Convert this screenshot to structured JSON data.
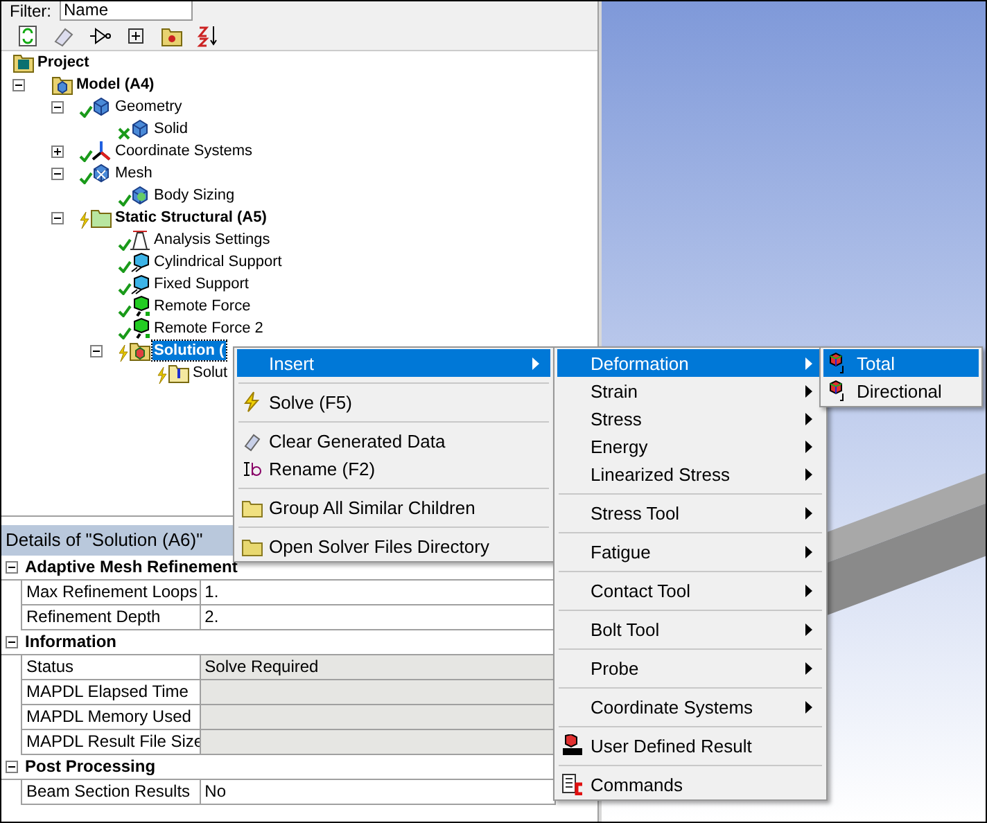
{
  "filter": {
    "label": "Filter:",
    "value": "Name"
  },
  "tree": {
    "label": "Project",
    "selected": false,
    "kind": "project",
    "children": [
      {
        "label": "Model (A4)",
        "selected": false,
        "kind": "model",
        "expanded": true,
        "children": [
          {
            "label": "Geometry",
            "selected": false,
            "solved": true,
            "kind": "geometry",
            "expanded": true,
            "children": [
              {
                "label": "Solid",
                "selected": false,
                "solved": true,
                "kind": "body"
              }
            ]
          },
          {
            "label": "Coordinate Systems",
            "selected": false,
            "solved": true,
            "kind": "axes",
            "expanded": false
          },
          {
            "label": "Mesh",
            "selected": false,
            "solved": true,
            "kind": "mesh",
            "expanded": true,
            "children": [
              {
                "label": "Body Sizing",
                "selected": false,
                "solved": true,
                "kind": "sizing"
              }
            ]
          },
          {
            "label": "Static Structural (A5)",
            "selected": false,
            "solved": false,
            "kind": "analysis",
            "expanded": true,
            "children": [
              {
                "label": "Analysis Settings",
                "selected": false,
                "solved": true,
                "kind": "settings"
              },
              {
                "label": "Cylindrical Support",
                "selected": false,
                "solved": true,
                "kind": "support"
              },
              {
                "label": "Fixed Support",
                "selected": false,
                "solved": true,
                "kind": "support"
              },
              {
                "label": "Remote Force",
                "selected": false,
                "solved": true,
                "kind": "force"
              },
              {
                "label": "Remote Force 2",
                "selected": false,
                "solved": true,
                "kind": "force"
              },
              {
                "label": "Solution (",
                "selected": true,
                "solved": false,
                "kind": "solution",
                "expanded": true,
                "children": [
                  {
                    "label": "Solut",
                    "selected": false,
                    "solved": false,
                    "kind": "info"
                  }
                ]
              }
            ]
          }
        ]
      }
    ]
  },
  "details": {
    "title": "Details of \"Solution (A6)\"",
    "sections": [
      {
        "title": "Adaptive Mesh Refinement",
        "expanded": true,
        "rows": [
          {
            "label": "Max Refinement Loops",
            "value": "1.",
            "readonly": false
          },
          {
            "label": "Refinement Depth",
            "value": "2.",
            "readonly": false
          }
        ]
      },
      {
        "title": "Information",
        "expanded": true,
        "rows": [
          {
            "label": "Status",
            "value": "Solve Required",
            "readonly": true
          },
          {
            "label": "MAPDL Elapsed Time",
            "readonly": true
          },
          {
            "label": "MAPDL Memory Used",
            "readonly": true
          },
          {
            "label": "MAPDL Result File Size",
            "readonly": true
          }
        ]
      },
      {
        "title": "Post Processing",
        "expanded": true,
        "rows": [
          {
            "label": "Beam Section Results",
            "value": "No",
            "readonly": false
          }
        ]
      }
    ]
  },
  "context_menu": [
    [
      {
        "label": "Insert",
        "kind": "submenu",
        "selected": true
      }
    ],
    [
      {
        "label": "Solve (F5)",
        "kind": "action",
        "selected": false
      }
    ],
    [
      {
        "label": "Clear Generated Data",
        "kind": "action",
        "selected": false
      },
      {
        "label": "Rename (F2)",
        "kind": "action",
        "selected": false
      }
    ],
    [
      {
        "label": "Group All Similar Children",
        "kind": "action",
        "selected": false
      }
    ],
    [
      {
        "label": "Open Solver Files Directory",
        "kind": "action",
        "selected": false
      }
    ]
  ],
  "insert_menu": [
    [
      {
        "label": "Deformation",
        "kind": "submenu",
        "selected": true
      },
      {
        "label": "Strain",
        "kind": "submenu",
        "selected": false
      },
      {
        "label": "Stress",
        "kind": "submenu",
        "selected": false
      },
      {
        "label": "Energy",
        "kind": "submenu",
        "selected": false
      },
      {
        "label": "Linearized Stress",
        "kind": "submenu",
        "selected": false
      }
    ],
    [
      {
        "label": "Stress Tool",
        "kind": "submenu",
        "selected": false
      }
    ],
    [
      {
        "label": "Fatigue",
        "kind": "submenu",
        "selected": false
      }
    ],
    [
      {
        "label": "Contact Tool",
        "kind": "submenu",
        "selected": false
      }
    ],
    [
      {
        "label": "Bolt Tool",
        "kind": "submenu",
        "selected": false
      }
    ],
    [
      {
        "label": "Probe",
        "kind": "submenu",
        "selected": false
      }
    ],
    [
      {
        "label": "Coordinate Systems",
        "kind": "submenu",
        "selected": false
      }
    ],
    [
      {
        "label": "User Defined Result",
        "kind": "action",
        "selected": false
      }
    ],
    [
      {
        "label": "Commands",
        "kind": "action",
        "selected": false
      }
    ]
  ],
  "deformation_menu": [
    [
      {
        "label": "Total",
        "selected": true
      },
      {
        "label": "Directional",
        "selected": false
      }
    ]
  ]
}
